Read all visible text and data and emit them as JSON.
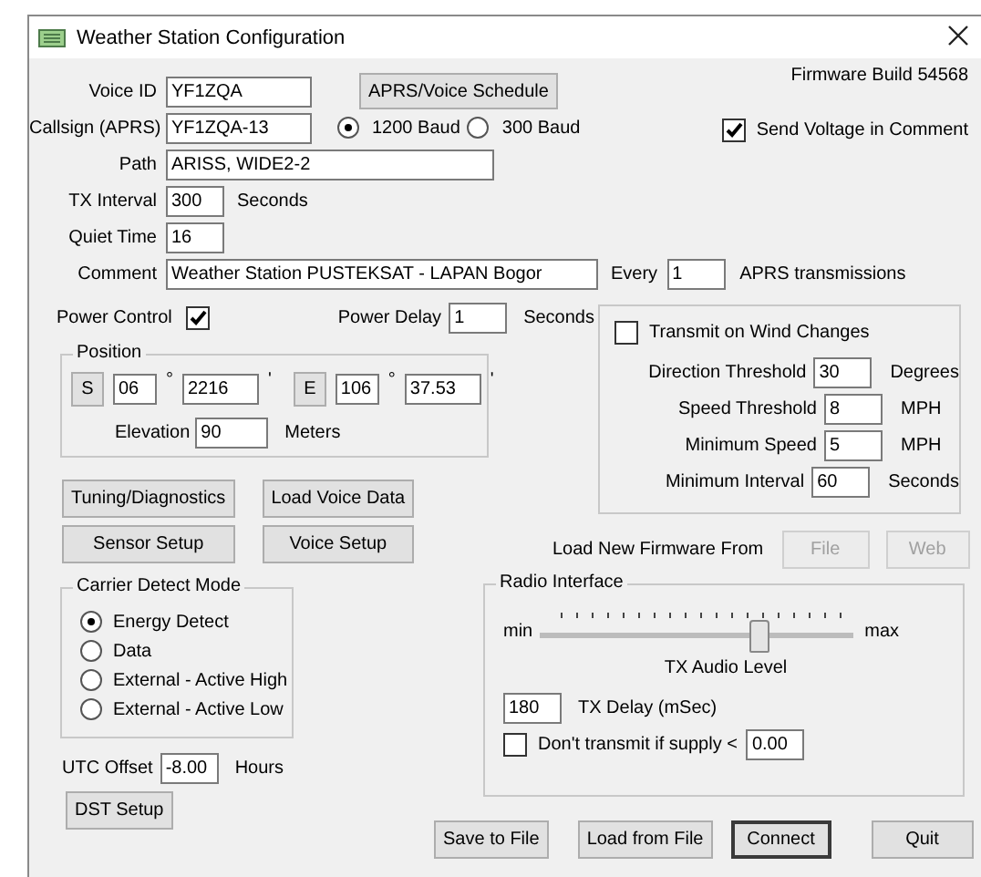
{
  "window": {
    "title": "Weather Station Configuration"
  },
  "firmware_build": "Firmware Build 54568",
  "voice_id": {
    "label": "Voice ID",
    "value": "YF1ZQA"
  },
  "schedule_button": "APRS/Voice Schedule",
  "callsign": {
    "label": "Callsign (APRS)",
    "value": "YF1ZQA-13"
  },
  "baud": [
    {
      "label": "1200 Baud",
      "selected": true
    },
    {
      "label": "300 Baud",
      "selected": false
    }
  ],
  "send_voltage": {
    "label": "Send Voltage in Comment",
    "checked": true
  },
  "path": {
    "label": "Path",
    "value": "ARISS, WIDE2-2"
  },
  "tx_interval": {
    "label": "TX Interval",
    "value": "300",
    "unit": "Seconds"
  },
  "quiet_time": {
    "label": "Quiet Time",
    "value": "16"
  },
  "comment": {
    "label": "Comment",
    "value": "Weather Station PUSTEKSAT - LAPAN Bogor"
  },
  "every": {
    "label": "Every",
    "value": "1",
    "unit": "APRS transmissions"
  },
  "power_control": {
    "label": "Power Control",
    "checked": true
  },
  "power_delay": {
    "label": "Power Delay",
    "value": "1",
    "unit": "Seconds"
  },
  "position": {
    "title": "Position",
    "latitude": {
      "hemisphere": "S",
      "degrees": "06",
      "degree_mark": "°",
      "minutes": "2216",
      "minute_mark": "'"
    },
    "longitude": {
      "hemisphere": "E",
      "degrees": "106",
      "degree_mark": "°",
      "minutes": "37.53",
      "minute_mark": "'"
    },
    "elevation": {
      "label": "Elevation",
      "value": "90",
      "unit": "Meters"
    }
  },
  "tool_buttons": [
    "Tuning/Diagnostics",
    "Load Voice Data",
    "Sensor Setup",
    "Voice Setup"
  ],
  "wind": {
    "checkbox": {
      "label": "Transmit on Wind Changes",
      "checked": false
    },
    "rows": [
      {
        "label": "Direction Threshold",
        "value": "30",
        "unit": "Degrees"
      },
      {
        "label": "Speed Threshold",
        "value": "8",
        "unit": "MPH"
      },
      {
        "label": "Minimum Speed",
        "value": "5",
        "unit": "MPH"
      },
      {
        "label": "Minimum Interval",
        "value": "60",
        "unit": "Seconds"
      }
    ]
  },
  "firmware": {
    "label": "Load New Firmware From",
    "buttons": [
      {
        "label": "File",
        "disabled": true
      },
      {
        "label": "Web",
        "disabled": true
      }
    ]
  },
  "carrier_detect": {
    "title": "Carrier Detect Mode",
    "options": [
      {
        "label": "Energy Detect",
        "selected": true
      },
      {
        "label": "Data",
        "selected": false
      },
      {
        "label": "External - Active High",
        "selected": false
      },
      {
        "label": "External - Active Low",
        "selected": false
      }
    ]
  },
  "utc_offset": {
    "label": "UTC Offset",
    "value": "-8.00",
    "unit": "Hours"
  },
  "dst_button": "DST Setup",
  "radio": {
    "title": "Radio Interface",
    "slider": {
      "min_label": "min",
      "max_label": "max",
      "level": 0.72,
      "caption": "TX Audio Level"
    },
    "tx_delay": {
      "value": "180",
      "label": "TX Delay (mSec)"
    },
    "supply": {
      "label": "Don't transmit if supply <",
      "checked": false,
      "value": "0.00"
    }
  },
  "actions": [
    {
      "label": "Save to File",
      "default": false
    },
    {
      "label": "Load from File",
      "default": false
    },
    {
      "label": "Connect",
      "default": true
    },
    {
      "label": "Quit",
      "default": false
    }
  ]
}
